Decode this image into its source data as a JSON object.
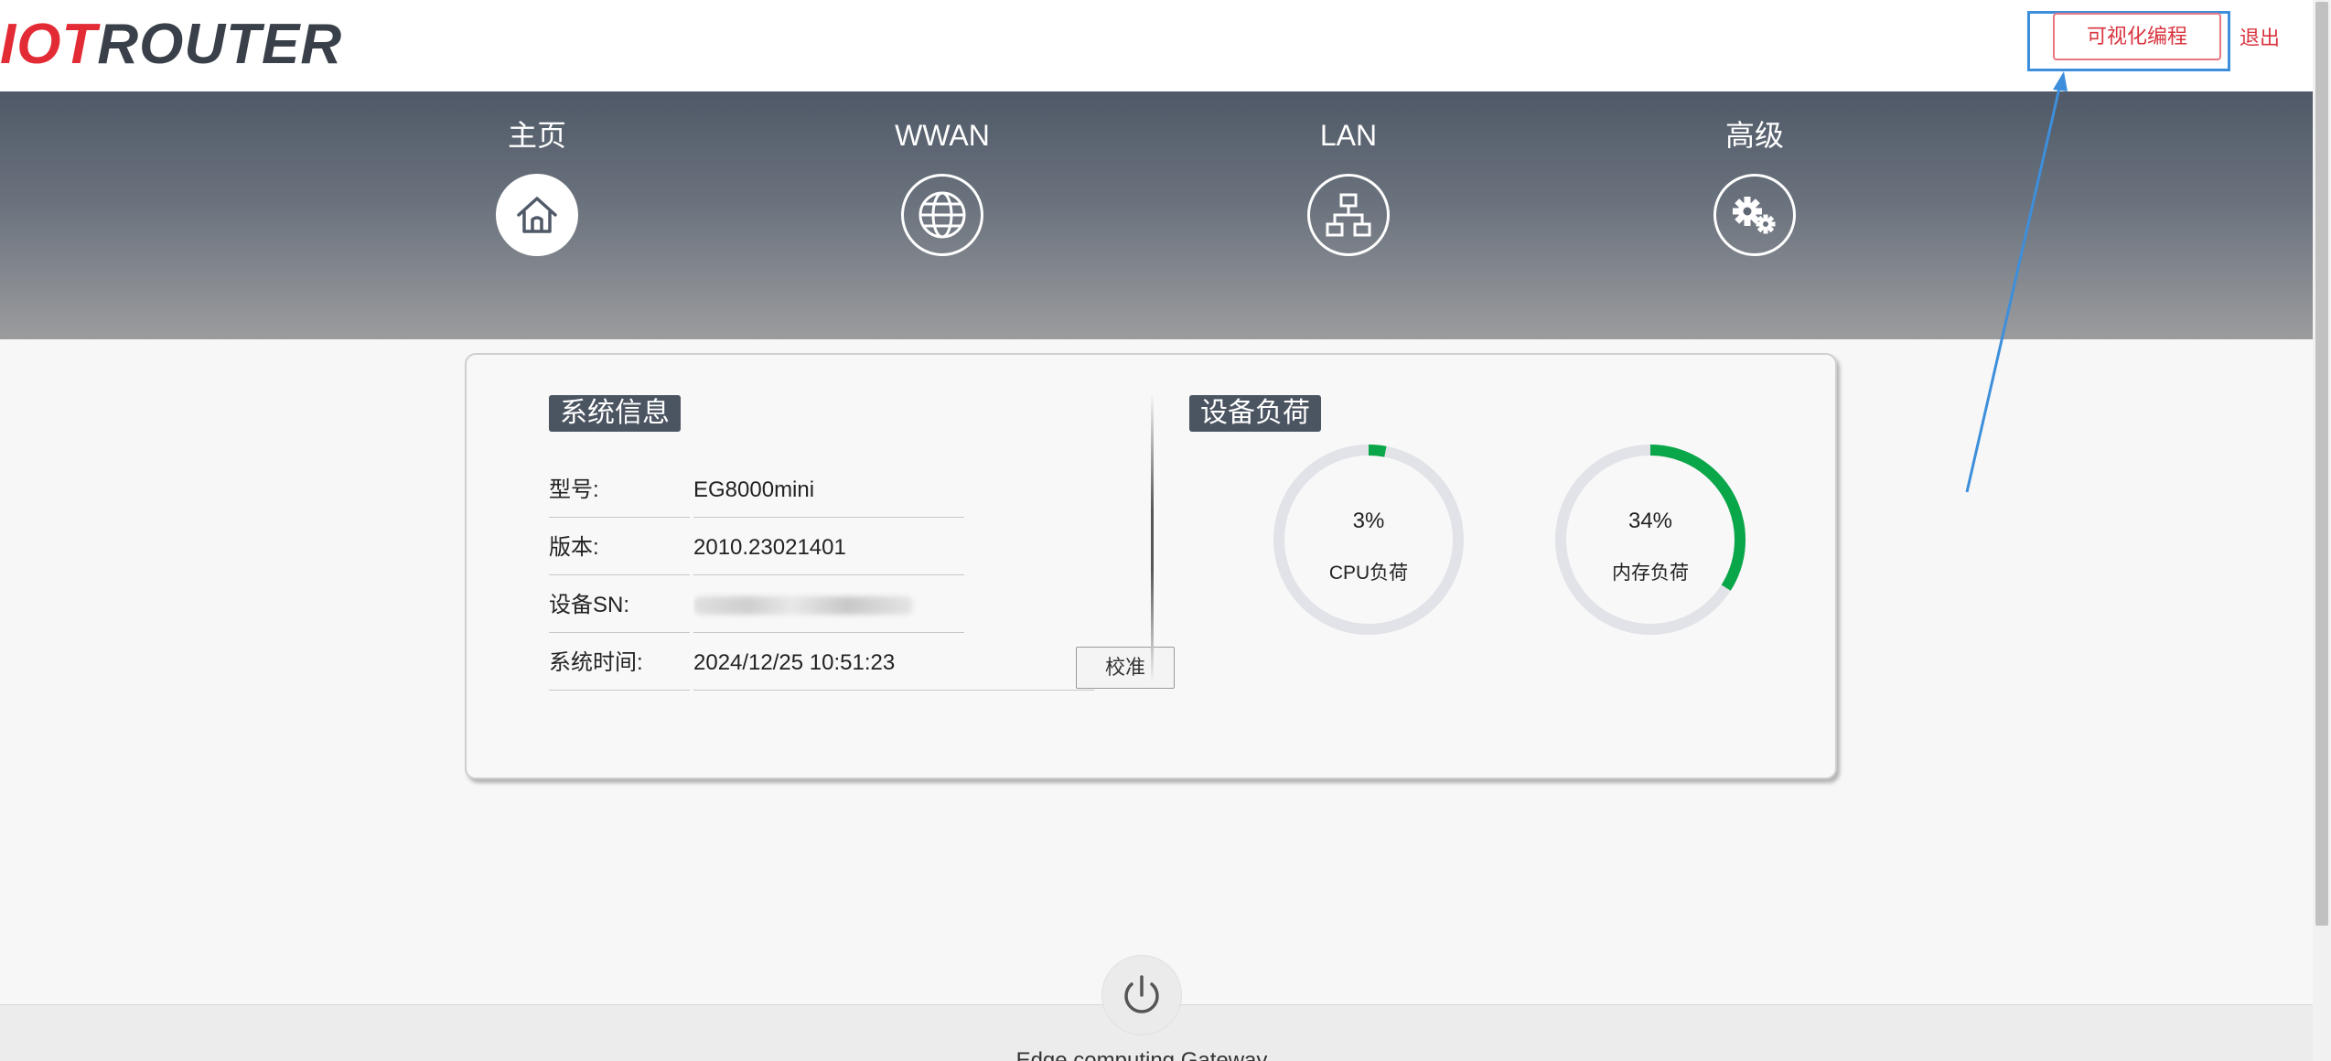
{
  "header": {
    "logo_part1": "IOT",
    "logo_part2": "ROUTER",
    "visual_programming_label": "可视化编程",
    "logout_label": "退出"
  },
  "nav": {
    "items": [
      {
        "label": "主页",
        "icon": "home-icon",
        "active": true
      },
      {
        "label": "WWAN",
        "icon": "globe-icon",
        "active": false
      },
      {
        "label": "LAN",
        "icon": "network-icon",
        "active": false
      },
      {
        "label": "高级",
        "icon": "gears-icon",
        "active": false
      }
    ]
  },
  "system_info": {
    "title": "系统信息",
    "rows": [
      {
        "label": "型号:",
        "value": "EG8000mini"
      },
      {
        "label": "版本:",
        "value": "2010.23021401"
      },
      {
        "label": "设备SN:",
        "value": ""
      },
      {
        "label": "系统时间:",
        "value": "2024/12/25 10:51:23"
      }
    ],
    "calibrate_label": "校准"
  },
  "device_load": {
    "title": "设备负荷",
    "cpu": {
      "value_text": "3%",
      "percent": 3,
      "label": "CPU负荷"
    },
    "memory": {
      "value_text": "34%",
      "percent": 34,
      "label": "内存负荷"
    }
  },
  "footer": {
    "text": "Edge computing Gateway"
  },
  "colors": {
    "brand_red": "#e32b36",
    "nav_dark": "#4f5967",
    "gauge_fill": "#0aa64a",
    "gauge_track": "#e1e3e8",
    "annotation_blue": "#3d8fdc"
  }
}
